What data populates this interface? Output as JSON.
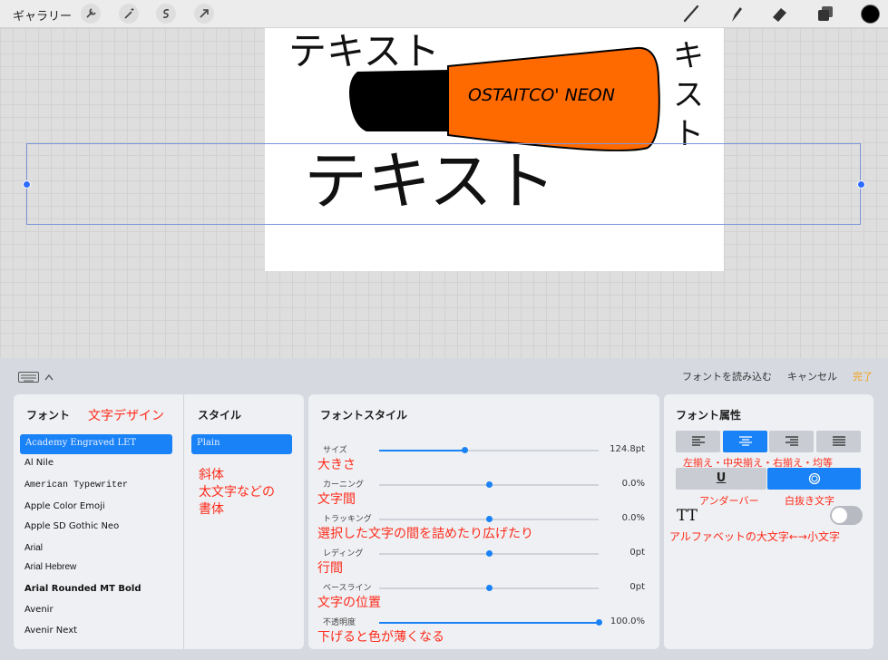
{
  "toolbar": {
    "gallery": "ギャラリー",
    "icons": [
      "wrench-icon",
      "magic-wand-icon",
      "selection-icon",
      "transform-arrow-icon"
    ],
    "right_icons": [
      "brush-icon",
      "smudge-icon",
      "eraser-icon",
      "layers-icon",
      "color-icon"
    ],
    "active_color": "#000000"
  },
  "canvas": {
    "text_top": "テキスト",
    "text_vertical": [
      "キ",
      "ス",
      "ト"
    ],
    "text_main": "テキスト",
    "marker_label": "OSTAITCO' NEON",
    "marker_color": "#ff6a00"
  },
  "actions": {
    "import_font": "フォントを読み込む",
    "cancel": "キャンセル",
    "done": "完了"
  },
  "font_panel": {
    "header": "フォント",
    "annotation": "文字デザイン",
    "fonts": [
      "Academy Engraved LET",
      "Al Nile",
      "American Typewriter",
      "Apple Color Emoji",
      "Apple SD Gothic Neo",
      "Arial",
      "Arial Hebrew",
      "Arial Rounded MT Bold",
      "Avenir",
      "Avenir Next"
    ]
  },
  "style_panel": {
    "header": "スタイル",
    "selected": "Plain",
    "annotation": [
      "斜体",
      "太文字などの",
      "書体"
    ]
  },
  "fontstyle_panel": {
    "header": "フォントスタイル",
    "sliders": [
      {
        "label": "サイズ",
        "value": "124.8pt",
        "level": 0.39,
        "annotation": "大きさ"
      },
      {
        "label": "カーニング",
        "value": "0.0%",
        "level": 0.5,
        "annotation": "文字間"
      },
      {
        "label": "トラッキング",
        "value": "0.0%",
        "level": 0.5,
        "annotation": "選択した文字の間を詰めたり広げたり"
      },
      {
        "label": "レディング",
        "value": "0pt",
        "level": 0.5,
        "annotation": "行間"
      },
      {
        "label": "ベースライン",
        "value": "0pt",
        "level": 0.5,
        "annotation": "文字の位置"
      },
      {
        "label": "不透明度",
        "value": "100.0%",
        "level": 1.0,
        "annotation": "下げると色が薄くなる"
      }
    ]
  },
  "attr_panel": {
    "header": "フォント属性",
    "align_icons": [
      "align-left-icon",
      "align-center-icon",
      "align-right-icon",
      "align-justify-icon"
    ],
    "align_annotation": "左揃え・中央揃え・右揃え・均等",
    "underline_label": "U",
    "underline_annotation": "アンダーバー",
    "outline_annotation": "白抜き文字",
    "caps_label": "TT",
    "caps_annotation": "アルファベットの大文字←→小文字"
  }
}
